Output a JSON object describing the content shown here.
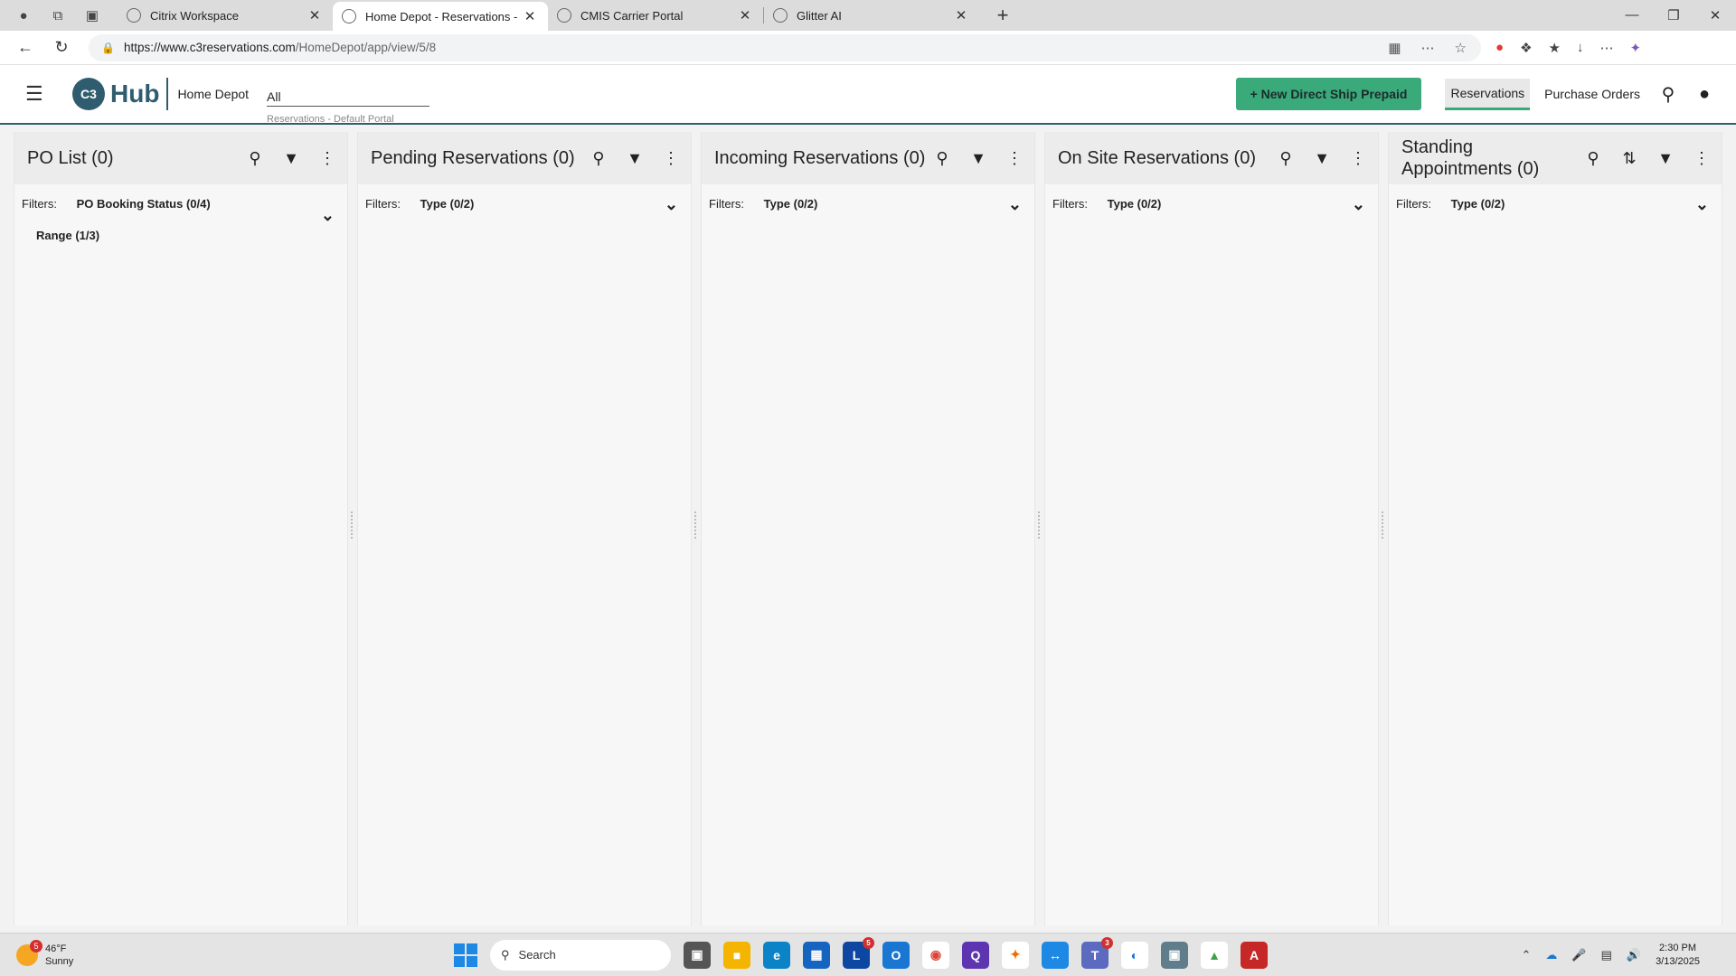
{
  "browser": {
    "tabs": [
      {
        "title": "Citrix Workspace",
        "active": false
      },
      {
        "title": "Home Depot - Reservations - Def",
        "active": true
      },
      {
        "title": "CMIS Carrier Portal",
        "active": false
      },
      {
        "title": "Glitter AI",
        "active": false
      }
    ],
    "url_domain": "https://www.c3reservations.com",
    "url_path": "/HomeDepot/app/view/5/8"
  },
  "header": {
    "logo_mark": "C3",
    "logo_text": "Hub",
    "org": "Home Depot",
    "portal_value": "All",
    "portal_sub": "Reservations - Default Portal",
    "new_button": "New Direct Ship Prepaid",
    "nav": [
      {
        "label": "Reservations",
        "active": true
      },
      {
        "label": "Purchase Orders",
        "active": false
      }
    ]
  },
  "columns": [
    {
      "title": "PO List (0)",
      "filters_label": "Filters:",
      "filter1": "PO Booking Status (0/4)",
      "filter2": "Range (1/3)",
      "sort": false
    },
    {
      "title": "Pending Reservations (0)",
      "filters_label": "Filters:",
      "filter1": "Type (0/2)",
      "filter2": "",
      "sort": false
    },
    {
      "title": "Incoming Reservations (0)",
      "filters_label": "Filters:",
      "filter1": "Type (0/2)",
      "filter2": "",
      "sort": false
    },
    {
      "title": "On Site Reservations (0)",
      "filters_label": "Filters:",
      "filter1": "Type (0/2)",
      "filter2": "",
      "sort": false
    },
    {
      "title": "Standing Appointments (0)",
      "filters_label": "Filters:",
      "filter1": "Type (0/2)",
      "filter2": "",
      "sort": true
    }
  ],
  "taskbar": {
    "weather_temp": "46°F",
    "weather_desc": "Sunny",
    "weather_badge": "5",
    "search_placeholder": "Search",
    "outlook_badge": "5",
    "teams_badge": "3",
    "time": "2:30 PM",
    "date": "3/13/2025"
  }
}
